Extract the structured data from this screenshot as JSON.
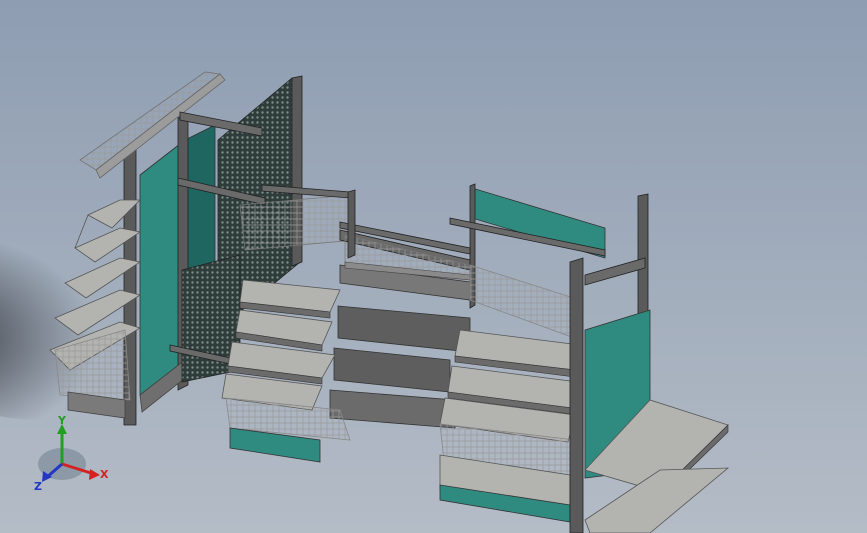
{
  "viewport": {
    "background_top": "#8e9db2",
    "background_bottom": "#b4bcc6"
  },
  "colors": {
    "frame": "#5a5a5a",
    "frame_dark": "#3c3c3c",
    "shelf_top": "#b3b3b0",
    "shelf_edge": "#6b6b6b",
    "panel_teal": "#2f8a80",
    "panel_teal_dark": "#1f6660",
    "mesh": "#2e3d3a",
    "wire": "#8f8f8f"
  },
  "triad": {
    "x_label": "X",
    "y_label": "Y",
    "z_label": "Z",
    "x_color": "#d42121",
    "y_color": "#1fa11f",
    "z_color": "#2437c4"
  }
}
